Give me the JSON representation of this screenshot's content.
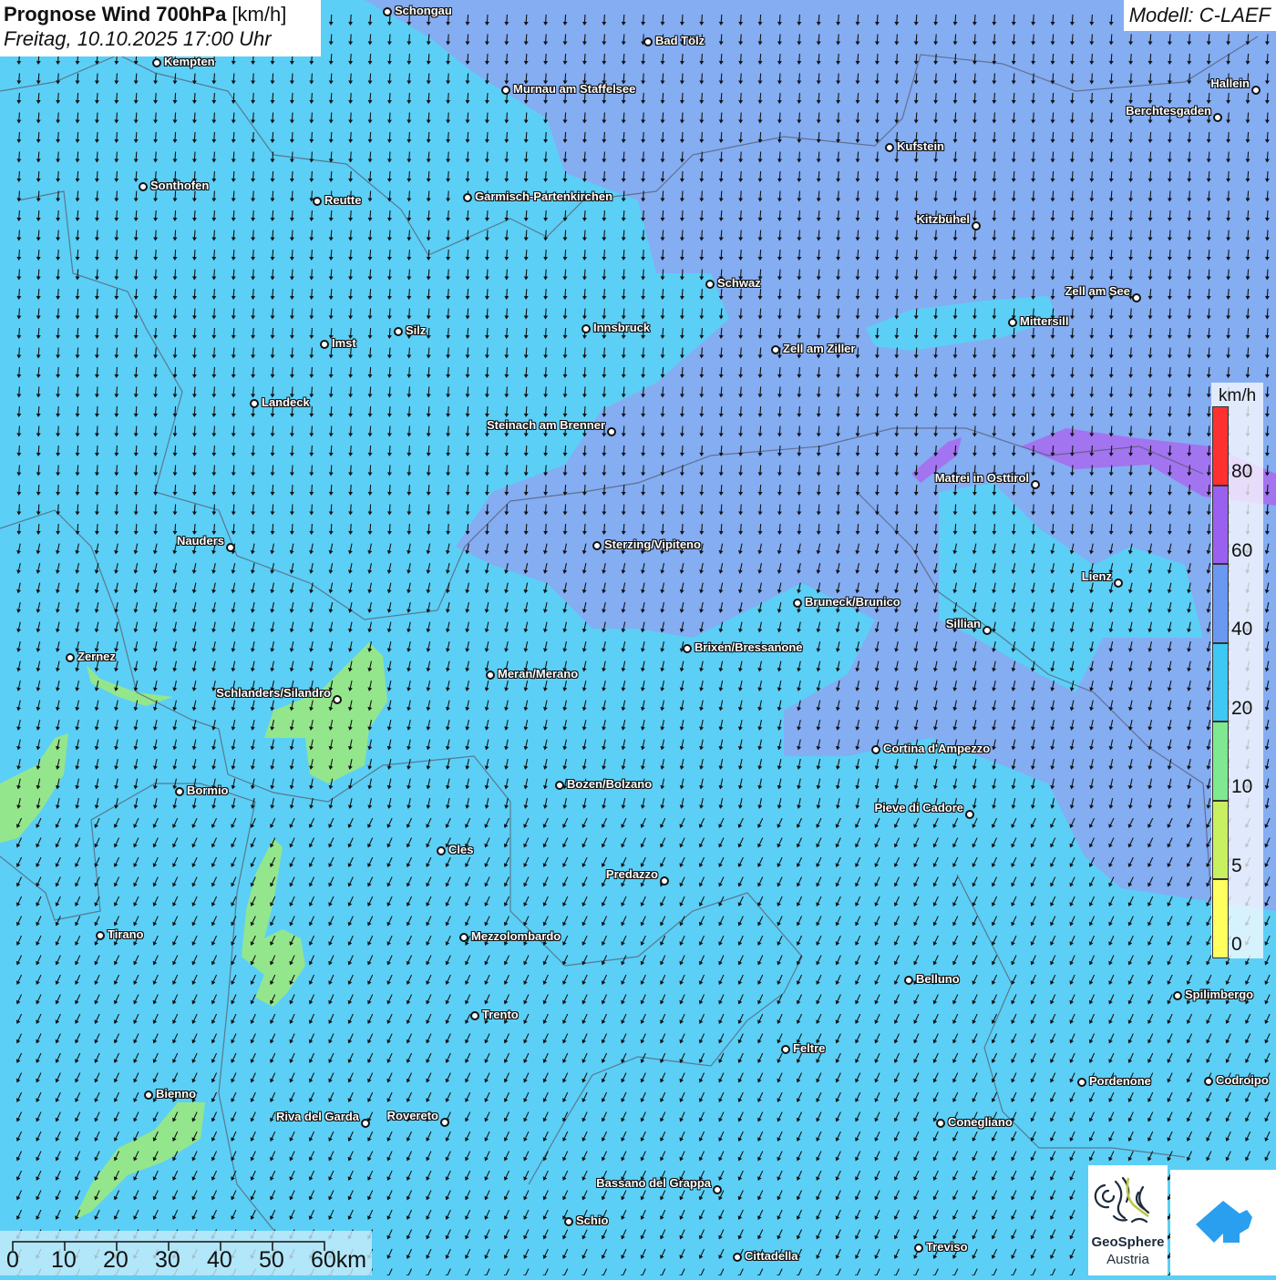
{
  "header": {
    "title": "Prognose Wind 700hPa",
    "unit": "[km/h]",
    "datetime": "Freitag, 10.10.2025 17:00 Uhr",
    "model": "Modell: C-LAEF"
  },
  "legend": {
    "unit": "km/h",
    "labels": [
      "80",
      "60",
      "40",
      "20",
      "10",
      "5",
      "0"
    ],
    "colors": [
      "#ff3030",
      "#9a60f0",
      "#6a98f2",
      "#3ec8f4",
      "#80e890",
      "#c8f060",
      "#ffff60"
    ]
  },
  "scalebar": {
    "labels": [
      "0",
      "10",
      "20",
      "30",
      "40",
      "50",
      "60km"
    ]
  },
  "colors": {
    "base": "#5ccff6",
    "moderate": "#88a8f2",
    "strong": "#a274f0",
    "calm": "#94e68c"
  },
  "wind_direction": "north to south",
  "cities": [
    "Schongau",
    "Bad Tölz",
    "Kempten",
    "Murnau am Staffelsee",
    "Hallein",
    "Berchtesgaden",
    "Kufstein",
    "Sonthofen",
    "Reutte",
    "Garmisch-Partenkirchen",
    "Kitzbühel",
    "Schwaz",
    "Zell am See",
    "Mittersill",
    "Innsbruck",
    "Silz",
    "Imst",
    "Zell am Ziller",
    "Landeck",
    "Steinach am Brenner",
    "Matrei in Osttirol",
    "Nauders",
    "Sterzing/Vipiteno",
    "Lienz",
    "Bruneck/Brunico",
    "Sillian",
    "Brixen/Bressanone",
    "Zernez",
    "Meran/Merano",
    "Schlanders/Silandro",
    "Cortina d'Ampezzo",
    "Bozen/Bolzano",
    "Bormio",
    "Pieve di Cadore",
    "Cles",
    "Predazzo",
    "Tirano",
    "Mezzolombardo",
    "Belluno",
    "Spilimbergo",
    "Trento",
    "Feltre",
    "Pordenone",
    "Codroipo",
    "Bienno",
    "Riva del Garda",
    "Rovereto",
    "Conegliano",
    "Bassano del Grappa",
    "Schio",
    "Treviso",
    "Cittadella"
  ],
  "logos": {
    "geosphere_line1": "GeoSphere",
    "geosphere_line2": "Austria"
  }
}
